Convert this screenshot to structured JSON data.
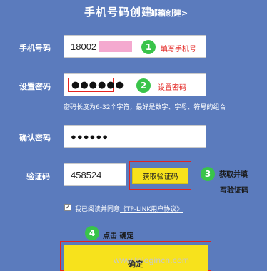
{
  "header": {
    "active_tab": "手机号码创建",
    "email_tab": "邮箱创建>"
  },
  "form": {
    "phone_label": "手机号码",
    "phone_value": "18002",
    "password_label": "设置密码",
    "password_value": "●●●●●●",
    "password_hint": "密码长度为6-32个字符，最好是数字、字母、符号的组合",
    "confirm_label": "确认密码",
    "confirm_value": "●●●●●●",
    "code_label": "验证码",
    "code_value": "458524",
    "get_code_button": "获取验证码",
    "agree_prefix": "我已阅读并同意",
    "agree_link": "《TP-LINK用户协议》",
    "agree_checked": "✓",
    "confirm_button": "确定"
  },
  "annotations": {
    "step1_number": "1",
    "step1_text": "填写手机号",
    "step2_number": "2",
    "step2_text": "设置密码",
    "step3_number": "3",
    "step3_line1": "获取并填",
    "step3_line2": "写验证码",
    "step4_number": "4",
    "step4_text": "点击 确定"
  },
  "watermark": "www.tplogincn.com",
  "colors": {
    "background": "#5b7bbd",
    "button_yellow": "#f7e21c",
    "annotation_red": "#e3231f",
    "step_green": "#39c44a"
  }
}
